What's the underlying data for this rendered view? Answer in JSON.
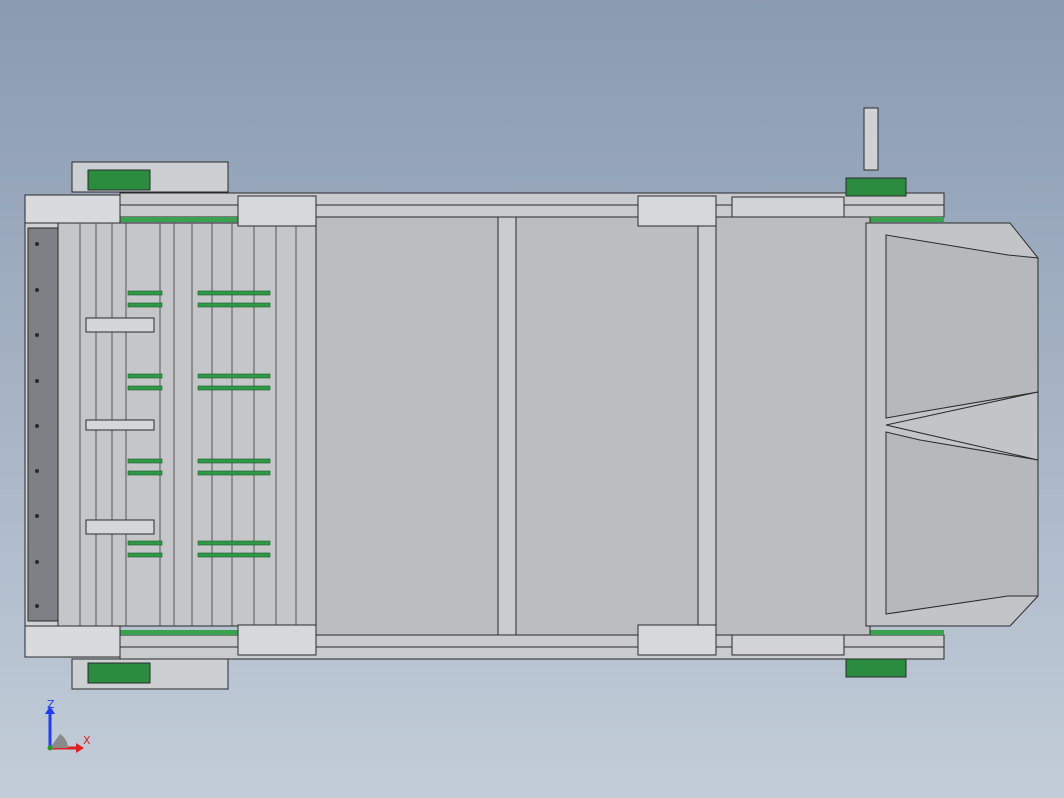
{
  "colors": {
    "background_top": "#8a9bb1",
    "background_bottom": "#c3cdd9",
    "frame_fill": "#c7c9cc",
    "panel_fill": "#b9bbbe",
    "outline": "#2a2a2a",
    "accent_green": "#1f8a3a",
    "axis_x": "#e02020",
    "axis_y": "#20a020",
    "axis_z": "#1e3cff"
  },
  "viewport": {
    "model_description_icon": "belt-conveyor-assembly",
    "view_orientation": "top"
  },
  "triad": {
    "z_label": "Z",
    "x_label": "X"
  }
}
